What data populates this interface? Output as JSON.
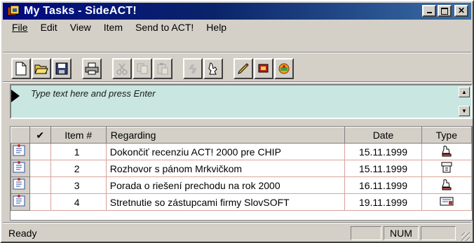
{
  "window": {
    "title": "My Tasks - SideACT!"
  },
  "menu": [
    "File",
    "Edit",
    "View",
    "Item",
    "Send to ACT!",
    "Help"
  ],
  "toolbar": [
    {
      "name": "new-icon"
    },
    {
      "name": "open-icon"
    },
    {
      "name": "save-icon"
    },
    {
      "name": "print-icon"
    },
    {
      "name": "cut-icon"
    },
    {
      "name": "copy-icon"
    },
    {
      "name": "paste-icon"
    },
    {
      "name": "delete-icon"
    },
    {
      "name": "find-icon"
    },
    {
      "name": "edit-icon"
    },
    {
      "name": "contact-icon"
    },
    {
      "name": "schedule-icon"
    }
  ],
  "entry": {
    "placeholder": "Type text here and press Enter"
  },
  "table": {
    "headers": [
      "",
      "✔",
      "Item #",
      "Regarding",
      "Date",
      "Type"
    ],
    "rows": [
      {
        "num": "1",
        "regarding": "Dokončiť recenziu ACT! 2000 pre CHIP",
        "date": "15.11.1999",
        "type": "call-icon"
      },
      {
        "num": "2",
        "regarding": "Rozhovor s pánom Mrkvičkom",
        "date": "15.11.1999",
        "type": "meeting-icon"
      },
      {
        "num": "3",
        "regarding": "Porada o riešení prechodu na rok 2000",
        "date": "16.11.1999",
        "type": "call-icon"
      },
      {
        "num": "4",
        "regarding": "Stretnutie so zástupcami firmy SlovSOFT",
        "date": "19.11.1999",
        "type": "todo-icon"
      }
    ]
  },
  "status": {
    "text": "Ready",
    "num": "NUM"
  },
  "colors": {
    "titlebar": "#0a246a",
    "entry_bg": "#c9e6e0",
    "grid_lines": "#d7a49a"
  }
}
